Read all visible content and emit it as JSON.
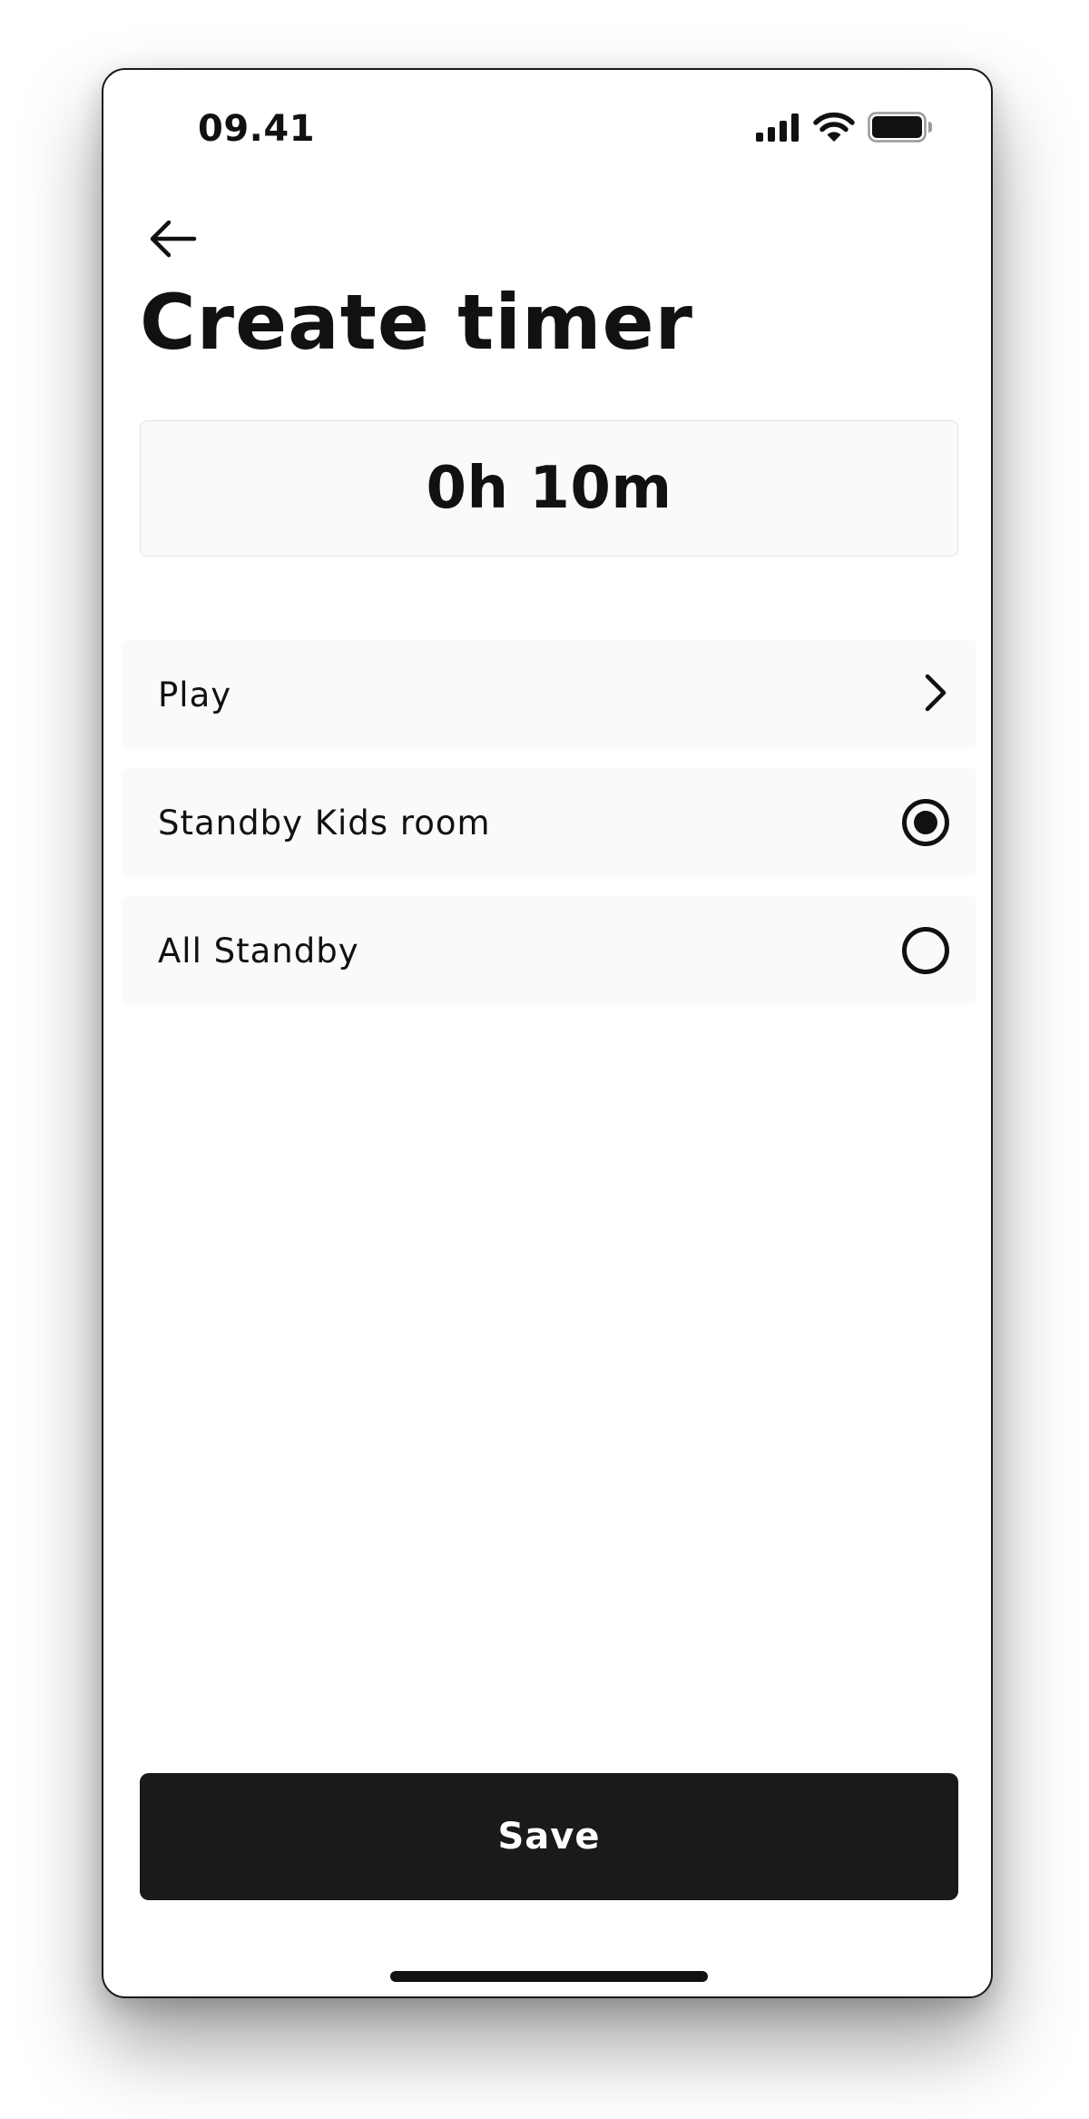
{
  "status_bar": {
    "time": "09.41",
    "icons": [
      "cellular-signal-icon",
      "wifi-icon",
      "battery-icon"
    ]
  },
  "header": {
    "back_icon": "arrow-left-icon",
    "title": "Create timer"
  },
  "duration": {
    "value": "0h 10m"
  },
  "options": [
    {
      "label": "Play",
      "control": "chevron-right-icon"
    },
    {
      "label": "Standby Kids room",
      "control": "radio",
      "selected": true
    },
    {
      "label": "All Standby",
      "control": "radio",
      "selected": false
    }
  ],
  "footer": {
    "save_label": "Save"
  },
  "colors": {
    "text": "#111111",
    "row_background": "#faf9fb",
    "button_background": "#1b1a1b",
    "button_text": "#ffffff"
  }
}
